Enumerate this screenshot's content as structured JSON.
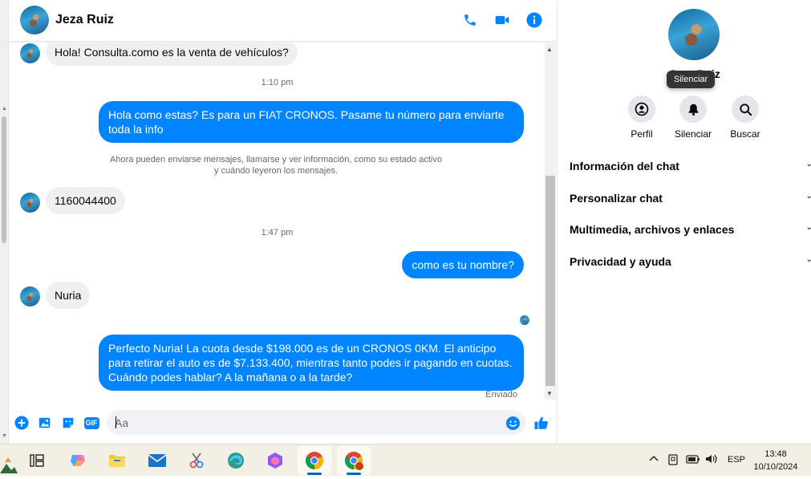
{
  "colors": {
    "accent": "#0084ff",
    "incoming_bubble": "#f0f0f0",
    "taskbar": "#f3efe4"
  },
  "header": {
    "contact_name": "Jeza Ruiz",
    "icons": [
      "phone-icon",
      "video-icon",
      "info-icon"
    ]
  },
  "messages": [
    {
      "type": "incoming",
      "text": "Hola! Consulta.como es la venta de vehículos?"
    },
    {
      "type": "time",
      "text": "1:10 pm"
    },
    {
      "type": "outgoing",
      "text": "Hola como estas?  Es para un FIAT CRONOS. Pasame tu número para enviarte toda la info"
    },
    {
      "type": "system",
      "line1": "Ahora pueden enviarse mensajes, llamarse y ver información, como su estado activo",
      "line2": "y cuándo leyeron los mensajes."
    },
    {
      "type": "incoming",
      "text": "1160044400"
    },
    {
      "type": "time",
      "text": "1:47 pm"
    },
    {
      "type": "outgoing",
      "text": "como es tu nombre?"
    },
    {
      "type": "incoming",
      "text": "Nuria"
    },
    {
      "type": "outgoing",
      "text": "Perfecto Nuria!  La cuota desde $198.000 es de un CRONOS 0KM. El anticipo para retirar el auto es de $7.133.400, mientras tanto podes ir pagando en cuotas. Cuándo podes hablar? A la mañana o a la tarde?"
    }
  ],
  "status": {
    "sent": "Enviado"
  },
  "composer": {
    "placeholder": "Aa",
    "icons": [
      "plus-icon",
      "image-icon",
      "sticker-icon",
      "gif-icon",
      "emoji-icon",
      "like-icon"
    ],
    "gif_label": "GIF"
  },
  "info_panel": {
    "name": "Jeza Ruiz",
    "tooltip": "Silenciar",
    "actions": [
      {
        "label": "Perfil",
        "icon": "profile-icon"
      },
      {
        "label": "Silenciar",
        "icon": "bell-icon"
      },
      {
        "label": "Buscar",
        "icon": "search-icon"
      }
    ],
    "sections": [
      "Información del chat",
      "Personalizar chat",
      "Multimedia, archivos y enlaces",
      "Privacidad y ayuda"
    ]
  },
  "taskbar": {
    "apps": [
      "task-view",
      "copilot",
      "file-explorer",
      "mail",
      "snipping-tool",
      "edge",
      "microsoft-365",
      "chrome",
      "chrome-profile"
    ],
    "tray": {
      "language": "ESP",
      "time": "13:48",
      "date": "10/10/2024"
    }
  }
}
